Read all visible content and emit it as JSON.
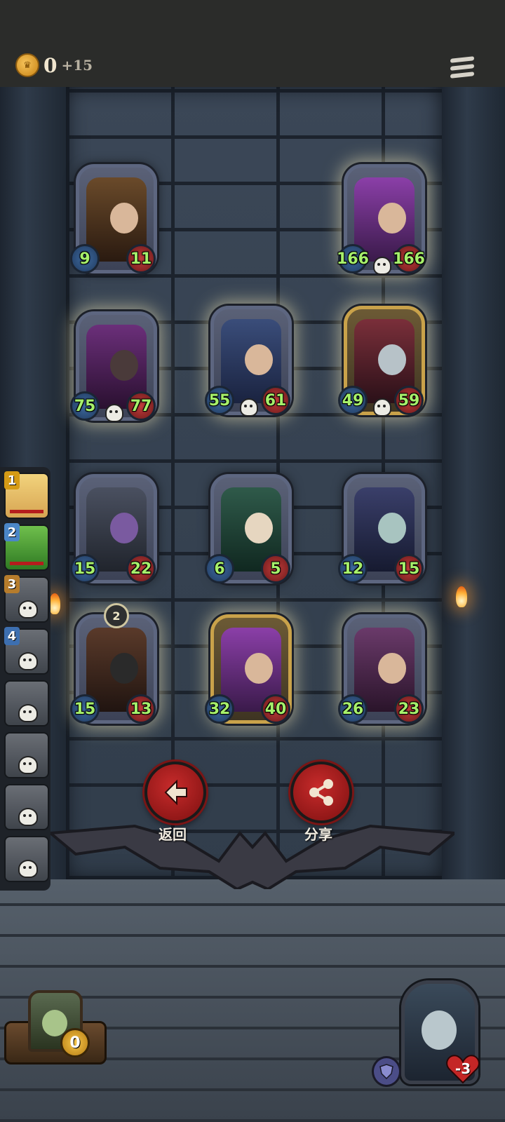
{
  "header": {
    "coins": "0",
    "coin_increment": "+15"
  },
  "board": {
    "top_row": [
      {
        "attack": "9",
        "health": "11",
        "golden": false,
        "dead": false,
        "color": "#6a4a2a"
      },
      {
        "attack": "166",
        "health": "166",
        "golden": false,
        "dead": true,
        "color": "#8b3fa8"
      }
    ],
    "row_2": [
      {
        "attack": "75",
        "health": "77",
        "golden": false,
        "dead": true,
        "color": "#6b2f7a"
      },
      {
        "attack": "55",
        "health": "61",
        "golden": false,
        "dead": true,
        "color": "#3a4d7a"
      },
      {
        "attack": "49",
        "health": "59",
        "golden": true,
        "dead": true,
        "color": "#7a2f3a"
      }
    ],
    "row_3": [
      {
        "attack": "15",
        "health": "22",
        "golden": false,
        "dead": false,
        "color": "#4a5060"
      },
      {
        "attack": "6",
        "health": "5",
        "golden": false,
        "dead": false,
        "color": "#2f5a4a"
      },
      {
        "attack": "12",
        "health": "15",
        "golden": false,
        "dead": false,
        "color": "#3a3f6a"
      }
    ],
    "row_4": [
      {
        "attack": "15",
        "health": "13",
        "golden": false,
        "dead": false,
        "tier": "2",
        "color": "#5a3a2a"
      },
      {
        "attack": "32",
        "health": "40",
        "golden": true,
        "dead": false,
        "color": "#8b3fa8"
      },
      {
        "attack": "26",
        "health": "23",
        "golden": false,
        "dead": false,
        "color": "#6a3a6a"
      }
    ]
  },
  "leaderboard": [
    {
      "rank": "1"
    },
    {
      "rank": "2"
    },
    {
      "rank": "3"
    },
    {
      "rank": "4"
    },
    {
      "rank": ""
    },
    {
      "rank": ""
    },
    {
      "rank": ""
    },
    {
      "rank": ""
    }
  ],
  "actions": {
    "back_label": "返回",
    "share_label": "分享"
  },
  "player": {
    "gold": "0",
    "health_delta": "-3"
  }
}
